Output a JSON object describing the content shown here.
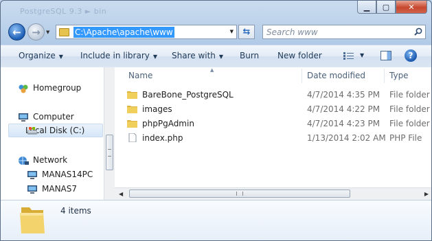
{
  "window": {
    "ghost_title": "PostgreSQL 9.3 ► bin",
    "controls": {
      "minimize": "▁",
      "maximize": "▢",
      "close": "✕"
    }
  },
  "address": {
    "path": "C:\\Apache\\apache\\www",
    "search_placeholder": "Search www"
  },
  "toolbar": {
    "organize": "Organize",
    "include_in_library": "Include in library",
    "share_with": "Share with",
    "burn": "Burn",
    "new_folder": "New folder"
  },
  "navigation": {
    "homegroup": "Homegroup",
    "computer": "Computer",
    "local_disk": "Local Disk (C:)",
    "network": "Network",
    "network_items": [
      "MANAS14PC",
      "MANAS7"
    ]
  },
  "columns": {
    "name": "Name",
    "date_modified": "Date modified",
    "type": "Type"
  },
  "files": [
    {
      "name": "BareBone_PostgreSQL",
      "date": "4/7/2014 4:35 PM",
      "type": "File folder",
      "icon": "folder-icon"
    },
    {
      "name": "images",
      "date": "4/7/2014 4:22 PM",
      "type": "File folder",
      "icon": "folder-icon"
    },
    {
      "name": "phpPgAdmin",
      "date": "4/7/2014 4:23 PM",
      "type": "File folder",
      "icon": "folder-icon"
    },
    {
      "name": "index.php",
      "date": "1/13/2014 2:02 AM",
      "type": "PHP File",
      "icon": "document-icon"
    }
  ],
  "details": {
    "item_count": "4 items"
  },
  "colors": {
    "selection": "#3399ff",
    "folder": "#e6c24f",
    "frame": "#bcd3ea"
  }
}
